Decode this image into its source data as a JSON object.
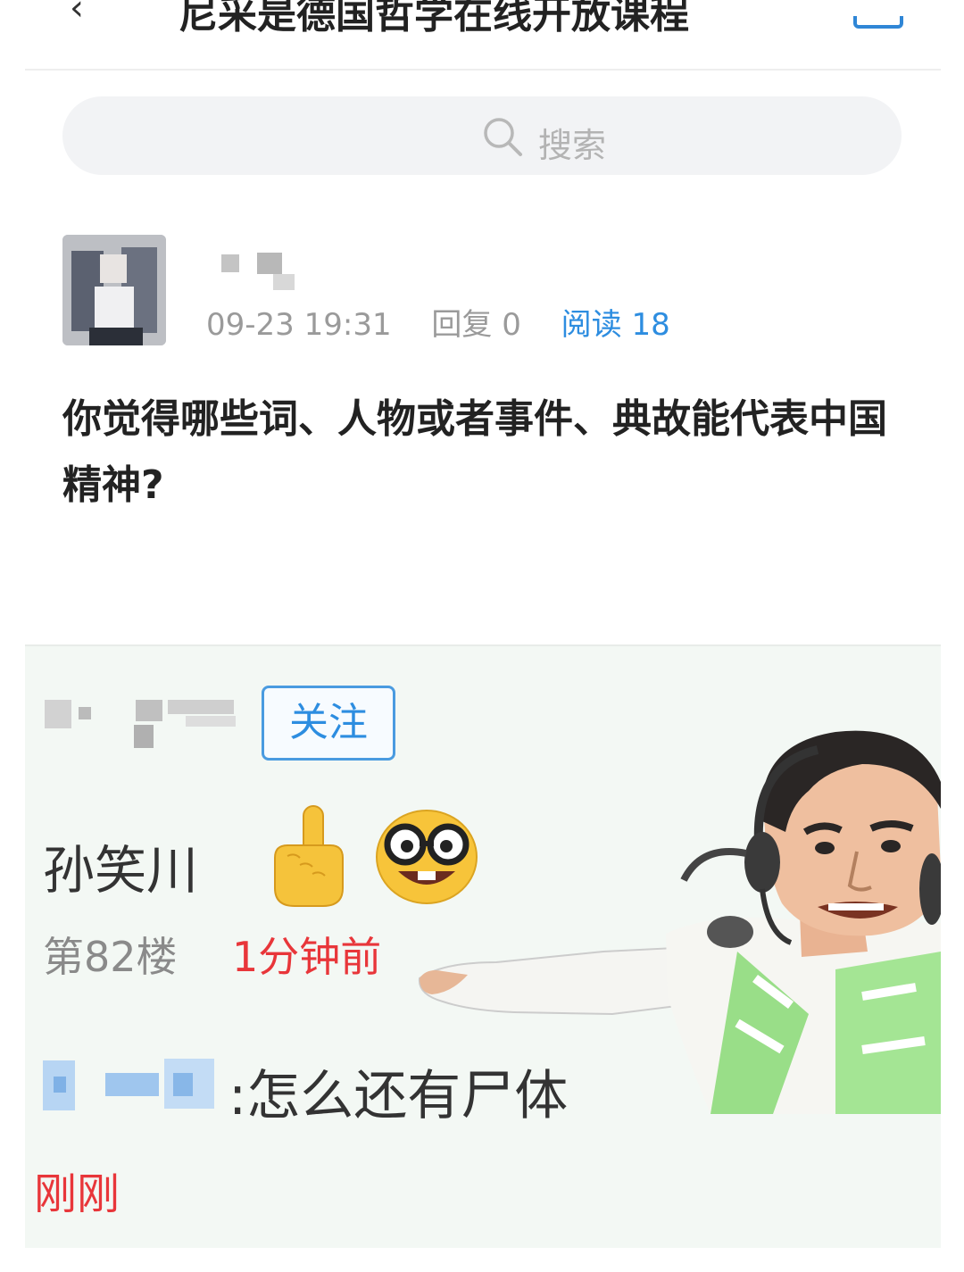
{
  "header": {
    "back_icon": "back-arrow-icon",
    "title": "尼采是德国哲学在线开放课程",
    "menu_icon": "menu-icon"
  },
  "search": {
    "placeholder": "搜索",
    "icon": "search-icon"
  },
  "post": {
    "date": "09-23 19:31",
    "replies": "回复 0",
    "reads": "阅读 18",
    "title": "你觉得哪些词、人物或者事件、典故能代表中国精神?"
  },
  "comment": {
    "follow_label": "关注",
    "name": "孙笑川",
    "emoji": [
      "pointing-finger-icon",
      "nerd-face-icon"
    ],
    "floor": "第82楼",
    "time": "1分钟前",
    "reply_sep": ":",
    "reply_text": "怎么还有尸体",
    "reply_time": "刚刚"
  },
  "colors": {
    "link_blue": "#2d8de0",
    "time_red": "#e8363a",
    "card_bg": "#f3f8f4"
  }
}
